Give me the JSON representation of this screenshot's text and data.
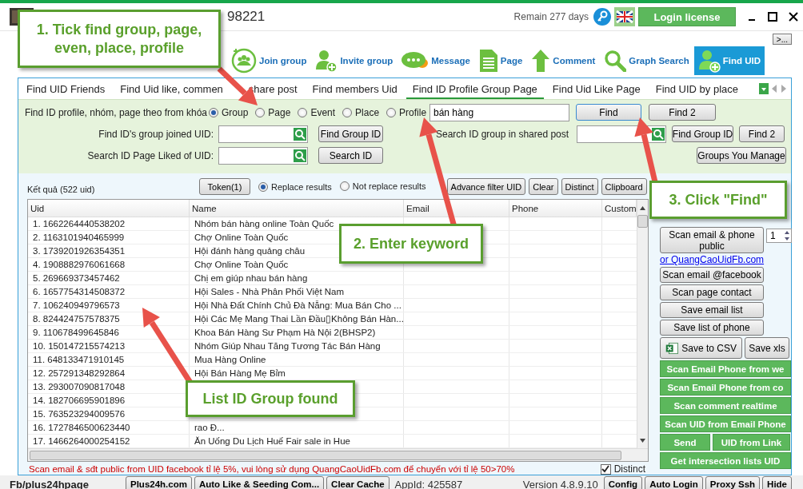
{
  "window": {
    "title": "98221",
    "remaining": "Remain 277 days",
    "login_button": "Login license",
    "overflow_button": ">..."
  },
  "toolbar": [
    {
      "label": "Join group",
      "kind": "people",
      "selected": false
    },
    {
      "label": "Invite group",
      "kind": "useradd",
      "selected": false
    },
    {
      "label": "Message",
      "kind": "chat",
      "selected": false
    },
    {
      "label": "Page",
      "kind": "document",
      "selected": false
    },
    {
      "label": "Comment",
      "kind": "up",
      "selected": false
    },
    {
      "label": "Graph Search",
      "kind": "search",
      "selected": false
    },
    {
      "label": "Find UID",
      "kind": "useradd",
      "selected": true
    }
  ],
  "tabs": [
    {
      "label": "Find UID Friends",
      "selected": false
    },
    {
      "label": "Find Uid like, commen",
      "label_continued": "share post",
      "selected": false
    },
    {
      "label": "Find members Uid",
      "selected": false
    },
    {
      "label": "Find ID Profile Group Page",
      "selected": true
    },
    {
      "label": "Find Uid Like Page",
      "selected": false
    },
    {
      "label": "Find UID by place",
      "selected": false
    }
  ],
  "search_form": {
    "keyword_label": "Find ID profile,  nhóm, page theo from khóa",
    "types": [
      {
        "label": "Group",
        "selected": true
      },
      {
        "label": "Page",
        "selected": false
      },
      {
        "label": "Event",
        "selected": false
      },
      {
        "label": "Place",
        "selected": false
      },
      {
        "label": "Profile",
        "selected": false
      }
    ],
    "keyword": "bán hàng",
    "find_button": "Find",
    "find2_button": "Find 2",
    "joined_label": "Find ID's group joined UID:",
    "joined_button": "Find Group ID",
    "shared_label": "Search ID group in shared post",
    "shared_button": "Find Group ID",
    "shared_find2_button": "Find 2",
    "liked_label": "Search ID Page Liked of UID:",
    "liked_button": "Search ID",
    "manage_button": "Groups You Manage"
  },
  "results": {
    "count_label": "Kết quả (522 uid)",
    "token_button": "Token(1)",
    "modes": [
      {
        "label": "Replace results",
        "selected": true
      },
      {
        "label": "Not replace results",
        "selected": false
      }
    ],
    "actions": [
      "Advance filter UID",
      "Clear",
      "Distinct",
      "Clipboard"
    ]
  },
  "table": {
    "columns": [
      "Uid",
      "Name",
      "Email",
      "Phone",
      "Custom"
    ],
    "rows": [
      {
        "uid": "1. 1662264440538202",
        "name": "Nhóm bán hàng online Toàn Quốc"
      },
      {
        "uid": "2. 1163101940465999",
        "name": "Chợ Online Toàn Quốc"
      },
      {
        "uid": "3. 1739201926354351",
        "name": "Hội đánh hàng quảng châu"
      },
      {
        "uid": "4. 1908882976061668",
        "name": "Chợ Online Toàn Quốc"
      },
      {
        "uid": "5. 269669373457462",
        "name": "Chị em giúp nhau bán hàng"
      },
      {
        "uid": "6. 1657754314508372",
        "name": "Hội Sales - Nhà Phân Phối Việt Nam"
      },
      {
        "uid": "7. 106240949796573",
        "name": "Hội Nhà Đất Chính Chủ Đà Nẵng: Mua Bán Cho ..."
      },
      {
        "uid": "8. 824424757578375",
        "name": "Hội Các Mẹ Mang Thai Lần Đầu▯Không Bán Hàn..."
      },
      {
        "uid": "9. 110678499645846",
        "name": "Khoa Bán Hàng Sư Phạm Hà Nội 2(BHSP2)"
      },
      {
        "uid": "10. 150147215574213",
        "name": "Nhóm Giúp Nhau Tăng Tương Tác Bán Hàng"
      },
      {
        "uid": "11. 648133471910145",
        "name": "Mua Hàng Online"
      },
      {
        "uid": "12. 257291348292864",
        "name": "Hội Bán Hàng Mẹ Bỉm"
      },
      {
        "uid": "13. 293007090817048"
      },
      {
        "uid": "14. 182706695901896"
      },
      {
        "uid": "15. 763523294009576"
      },
      {
        "uid": "16. 1727846500623440",
        "name": "rao Đ..."
      },
      {
        "uid": "17. 1466264000254152",
        "name": "Ăn Uống Du Lịch Huế Fair sale in Hue"
      }
    ]
  },
  "notice": "Scan email & sđt public from UID facebook tỉ lệ 5%, vui lòng sử dụng QuangCaoUidFb.com để chuyển với tỉ lệ 50>70%",
  "distinct": {
    "label": "Distinct",
    "checked": true
  },
  "side_panel": {
    "scan_public_button": "Scan email & phone public",
    "spin_value": "1",
    "link": "or QuangCaoUidFb.com",
    "buttons": [
      "Scan email @facebook",
      "Scan page contact",
      "Save email list",
      "Save list of phone"
    ],
    "csv_button": "Save to CSV",
    "xls_button": "Save xls",
    "green_buttons": [
      [
        "Scan Email Phone  from we"
      ],
      [
        "Scan Email Phone  from co"
      ],
      [
        "Scan comment realtime"
      ],
      [
        "Scan UID from Email Phone"
      ],
      [
        "Send",
        "UID from Link"
      ],
      [
        "Get intersection lists UID"
      ]
    ]
  },
  "status_bar": {
    "account": "Fb/plus24hpage",
    "left_buttons": [
      "Plus24h.com",
      "Auto Like & Seeding Com...",
      "Clear Cache"
    ],
    "app_id": "AppId: 425587",
    "version": "Version 4.8.9.10",
    "right_buttons": [
      "Config",
      "Auto Login",
      "Proxy Ssh",
      "Hide"
    ]
  },
  "callouts": [
    {
      "text": "1. Tick find group, page, even, place, profile"
    },
    {
      "text": "2. Enter keyword"
    },
    {
      "text": "3. Click \"Find\""
    },
    {
      "text": "List ID Group found"
    }
  ]
}
